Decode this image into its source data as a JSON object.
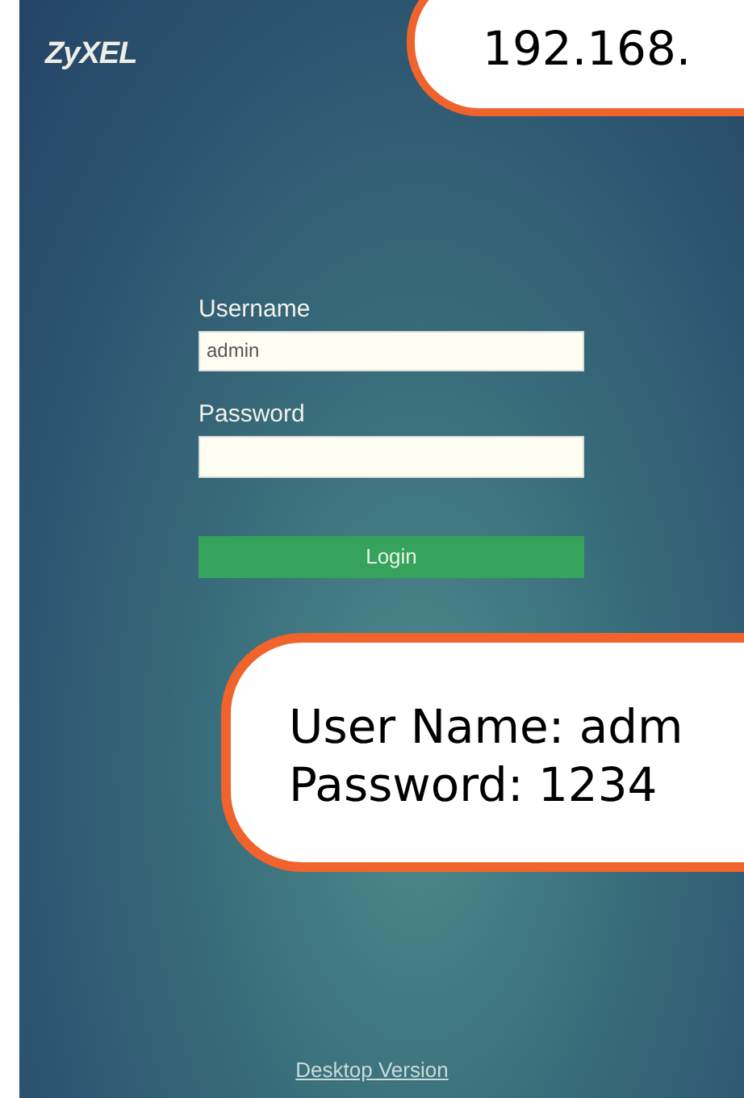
{
  "logo": "ZyXEL",
  "login_form": {
    "username_label": "Username",
    "username_value": "admin",
    "password_label": "Password",
    "login_button": "Login"
  },
  "footer_link": "Desktop Version",
  "callouts": [
    {
      "lines": [
        "192.168."
      ]
    },
    {
      "lines": [
        "User Name: adm",
        "Password: 1234"
      ]
    }
  ]
}
